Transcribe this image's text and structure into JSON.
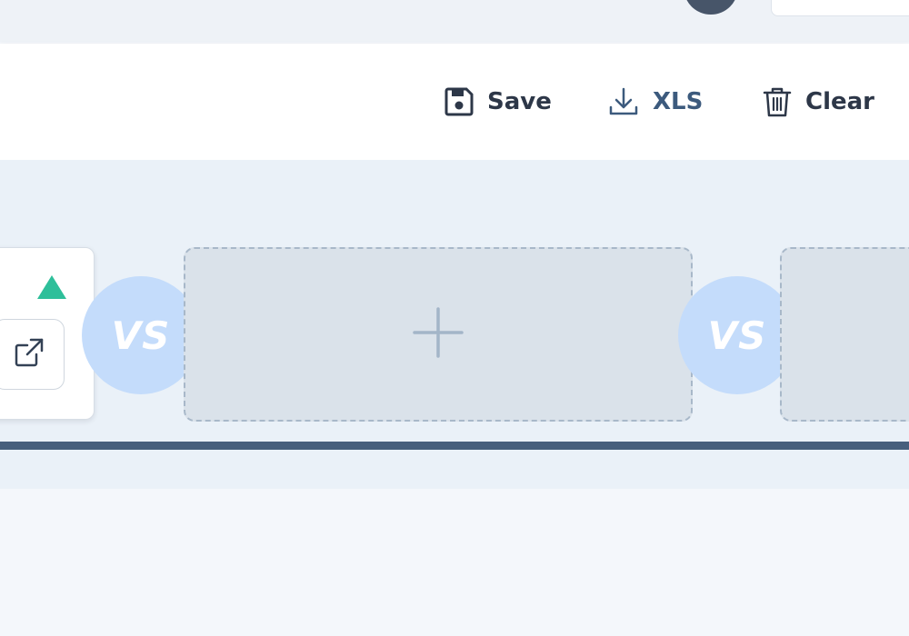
{
  "toolbar": {
    "save_label": "Save",
    "xls_label": "XLS",
    "clear_label": "Clear"
  },
  "comparison": {
    "vs_label_1": "VS",
    "vs_label_2": "VS"
  },
  "colors": {
    "trend_up": "#2ebf9a",
    "vs_badge": "#c4dcfb",
    "divider": "#475f7d",
    "xls_text": "#3c5a7d"
  },
  "icons": {
    "save": "save-icon",
    "xls": "download-icon",
    "clear": "trash-icon",
    "external": "external-link-icon",
    "add": "plus-icon",
    "trend": "triangle-up-icon"
  }
}
